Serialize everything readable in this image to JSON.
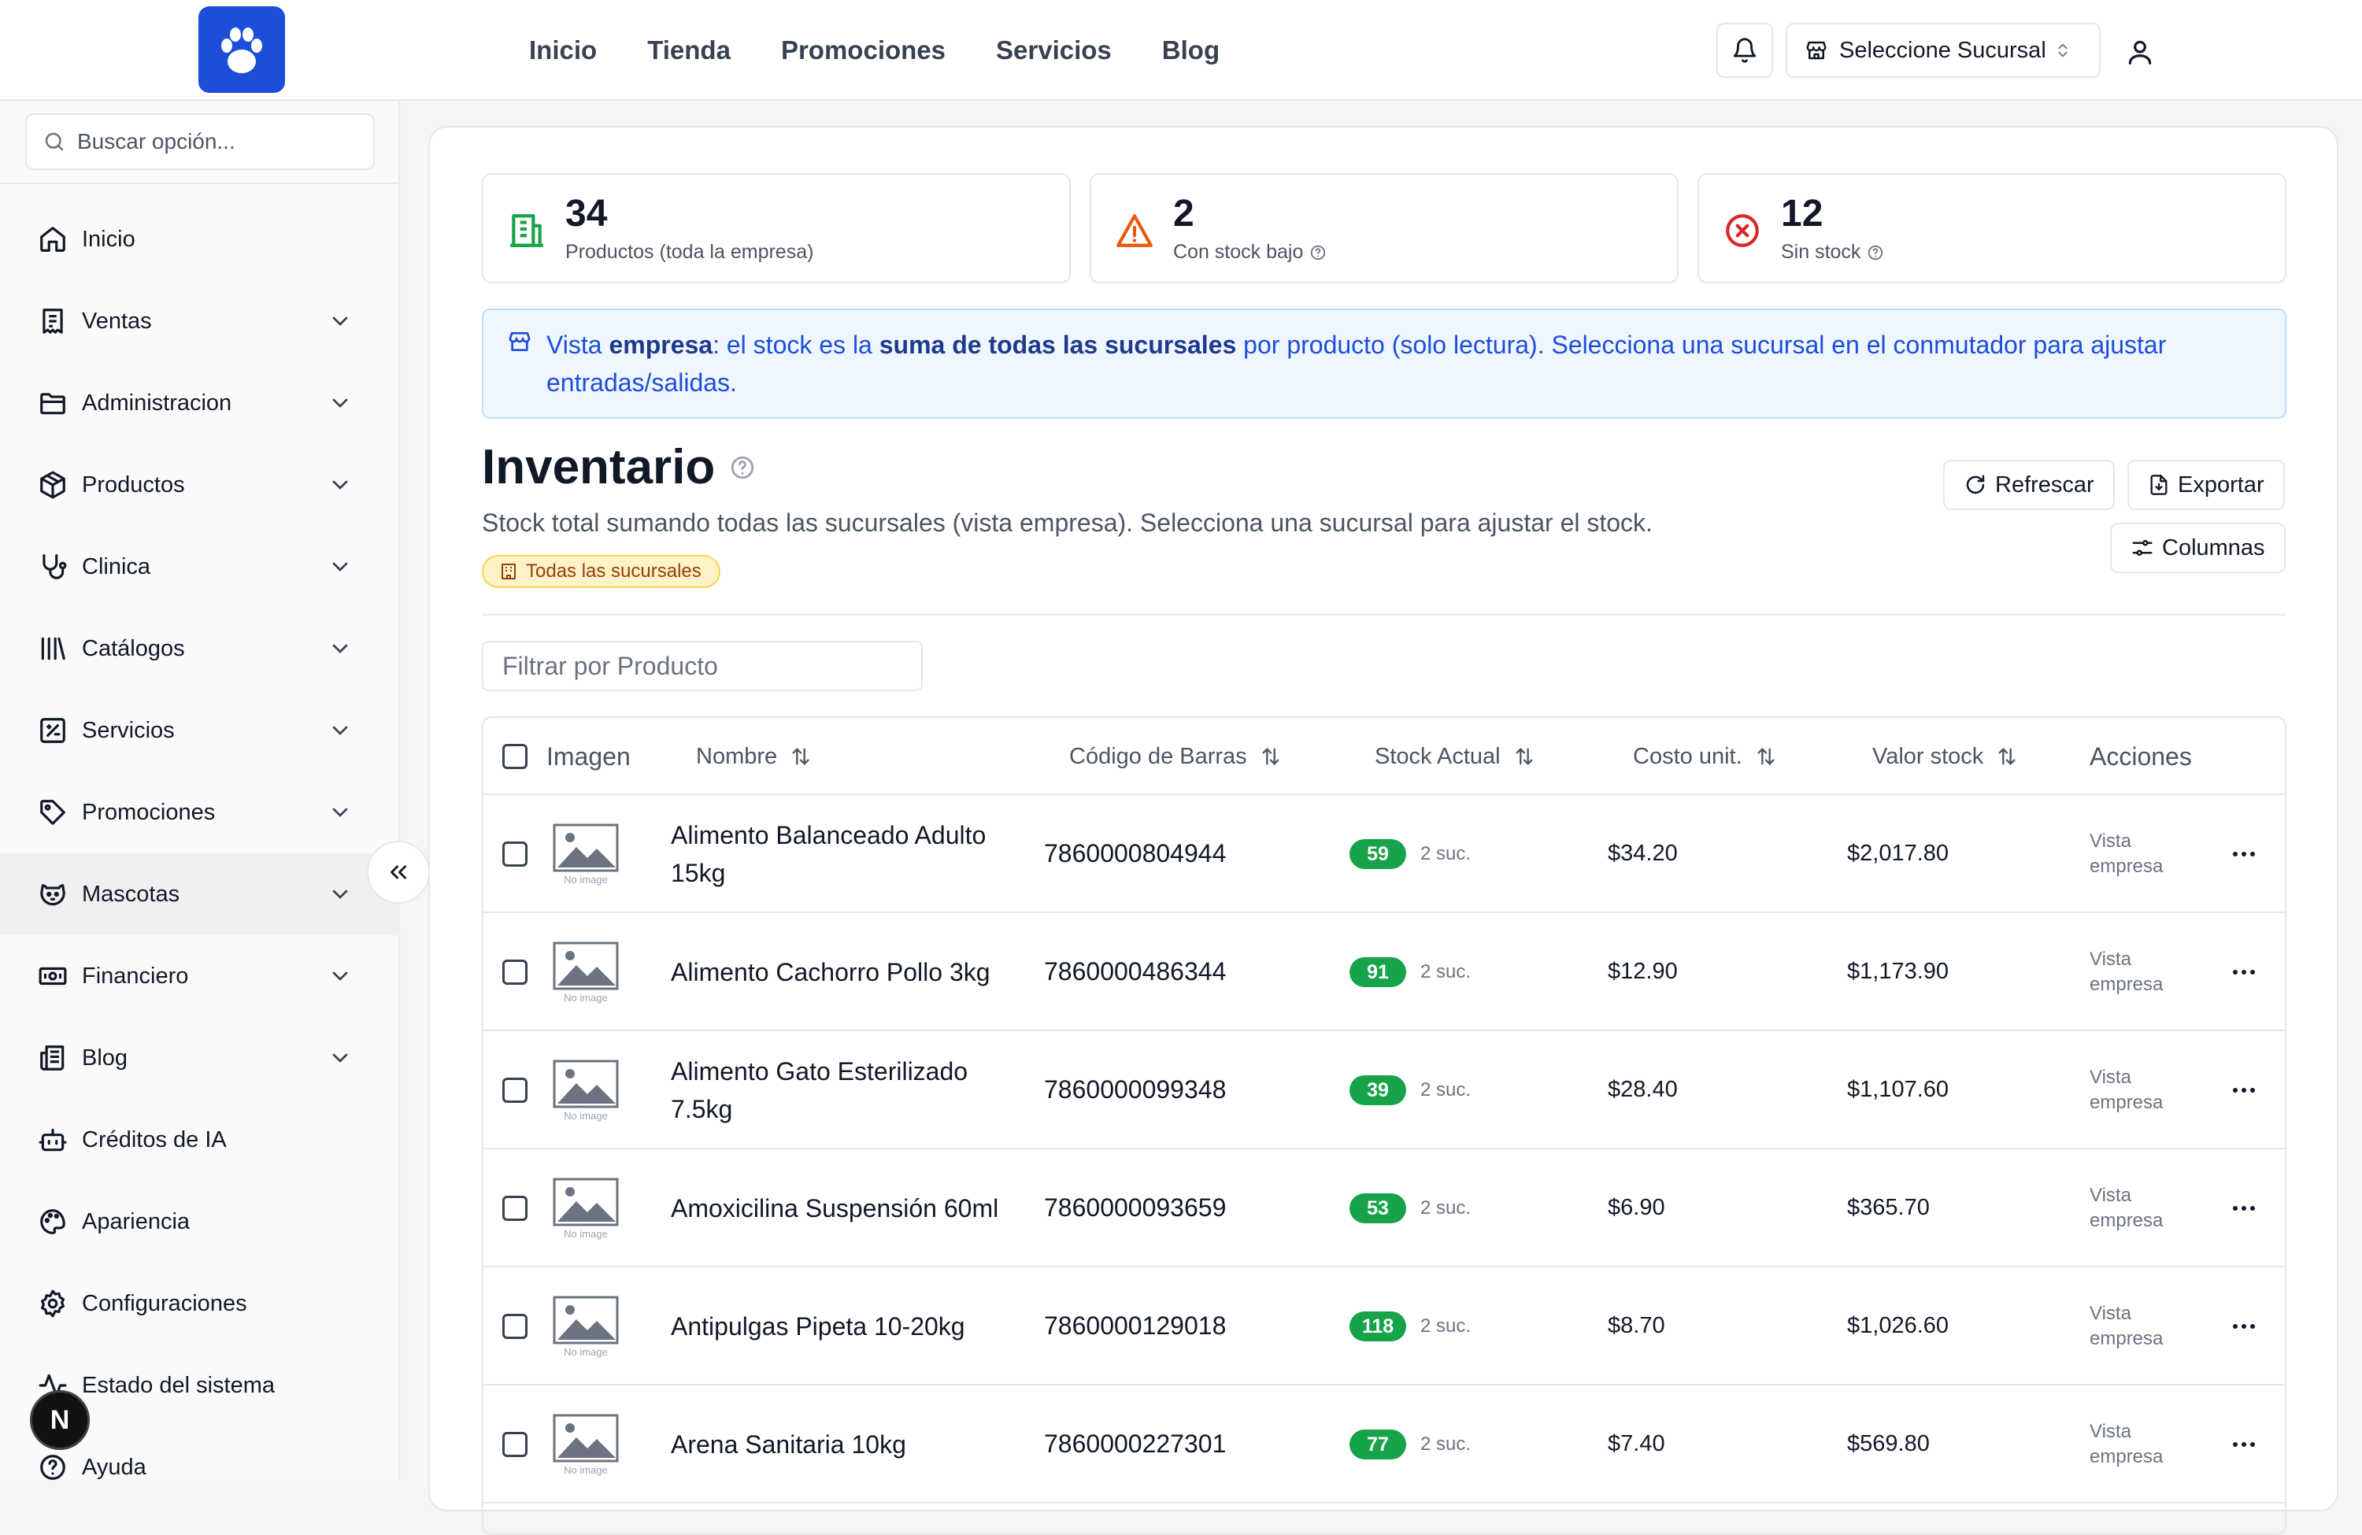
{
  "topbar": {
    "nav": [
      "Inicio",
      "Tienda",
      "Promociones",
      "Servicios",
      "Blog"
    ],
    "branch_selector": "Seleccione Sucursal"
  },
  "sidebar": {
    "search_placeholder": "Buscar opción...",
    "items": [
      {
        "label": "Inicio",
        "icon": "home-icon",
        "expandable": false
      },
      {
        "label": "Ventas",
        "icon": "receipt-icon",
        "expandable": true
      },
      {
        "label": "Administracion",
        "icon": "folder-icon",
        "expandable": true
      },
      {
        "label": "Productos",
        "icon": "package-icon",
        "expandable": true
      },
      {
        "label": "Clinica",
        "icon": "stethoscope-icon",
        "expandable": true
      },
      {
        "label": "Catálogos",
        "icon": "library-icon",
        "expandable": true
      },
      {
        "label": "Servicios",
        "icon": "service-icon",
        "expandable": true
      },
      {
        "label": "Promociones",
        "icon": "tag-icon",
        "expandable": true
      },
      {
        "label": "Mascotas",
        "icon": "pet-icon",
        "expandable": true
      },
      {
        "label": "Financiero",
        "icon": "banknote-icon",
        "expandable": true
      },
      {
        "label": "Blog",
        "icon": "newspaper-icon",
        "expandable": true
      },
      {
        "label": "Créditos de IA",
        "icon": "bot-icon",
        "expandable": false
      },
      {
        "label": "Apariencia",
        "icon": "palette-icon",
        "expandable": false
      },
      {
        "label": "Configuraciones",
        "icon": "gear-icon",
        "expandable": false
      },
      {
        "label": "Estado del sistema",
        "icon": "activity-icon",
        "expandable": false
      },
      {
        "label": "Ayuda",
        "icon": "help-icon",
        "expandable": false
      }
    ],
    "active_item": "Mascotas",
    "badge": "N"
  },
  "stats": [
    {
      "value": "34",
      "caption": "Productos (toda la empresa)",
      "icon": "building-icon",
      "color": "#16a34a"
    },
    {
      "value": "2",
      "caption": "Con stock bajo",
      "icon": "warning-icon",
      "color": "#ea580c"
    },
    {
      "value": "12",
      "caption": "Sin stock",
      "icon": "x-circle-icon",
      "color": "#dc2626"
    }
  ],
  "info": {
    "t1": "Vista ",
    "b1": "empresa",
    "t2": ": el stock es la ",
    "b2": "suma de todas las sucursales",
    "t3": " por producto (solo lectura). Selecciona una sucursal en el conmutador para ajustar entradas/salidas."
  },
  "page": {
    "title": "Inventario",
    "subtitle": "Stock total sumando todas las sucursales (vista empresa). Selecciona una sucursal para ajustar el stock.",
    "chip": "Todas las sucursales",
    "refresh": "Refrescar",
    "export": "Exportar",
    "columns": "Columnas",
    "filter_placeholder": "Filtrar por Producto"
  },
  "table": {
    "headers": [
      "Imagen",
      "Nombre",
      "Código de Barras",
      "Stock Actual",
      "Costo unit.",
      "Valor stock",
      "Acciones"
    ],
    "no_image": "No image",
    "rows": [
      {
        "name": "Alimento Balanceado Adulto 15kg",
        "barcode": "7860000804944",
        "stock": "59",
        "branches": "2 suc.",
        "cost": "$34.20",
        "value": "$2,017.80",
        "action": "Vista empresa"
      },
      {
        "name": "Alimento Cachorro Pollo 3kg",
        "barcode": "7860000486344",
        "stock": "91",
        "branches": "2 suc.",
        "cost": "$12.90",
        "value": "$1,173.90",
        "action": "Vista empresa"
      },
      {
        "name": "Alimento Gato Esterilizado 7.5kg",
        "barcode": "7860000099348",
        "stock": "39",
        "branches": "2 suc.",
        "cost": "$28.40",
        "value": "$1,107.60",
        "action": "Vista empresa"
      },
      {
        "name": "Amoxicilina Suspensión 60ml",
        "barcode": "7860000093659",
        "stock": "53",
        "branches": "2 suc.",
        "cost": "$6.90",
        "value": "$365.70",
        "action": "Vista empresa"
      },
      {
        "name": "Antipulgas Pipeta 10-20kg",
        "barcode": "7860000129018",
        "stock": "118",
        "branches": "2 suc.",
        "cost": "$8.70",
        "value": "$1,026.60",
        "action": "Vista empresa"
      },
      {
        "name": "Arena Sanitaria 10kg",
        "barcode": "7860000227301",
        "stock": "77",
        "branches": "2 suc.",
        "cost": "$7.40",
        "value": "$569.80",
        "action": "Vista empresa"
      }
    ]
  },
  "colors": {
    "accent": "#1d4ed8",
    "stock_badge": "#16a34a",
    "chip_bg": "#fef3c7",
    "info_bg": "#eff6ff"
  }
}
